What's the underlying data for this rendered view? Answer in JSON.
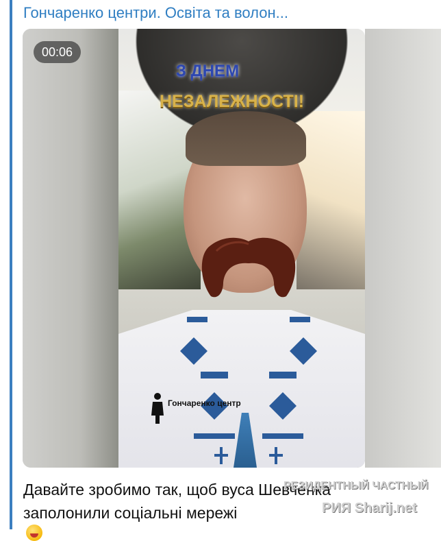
{
  "message": {
    "channel_title": "Гончаренко центри. Освіта та волон...",
    "caption_line1": "Давайте зробимо так, щоб вуса Шевченка",
    "caption_line2": "заполонили соціальні мережі",
    "caption_emoji": "face-with-tongue-emoji"
  },
  "video": {
    "duration": "00:06",
    "overlay_line1": "З ДНЕМ",
    "overlay_line2": "НЕЗАЛЕЖНОСТІ!",
    "logo_name": "Гончаренко центр"
  },
  "watermark": {
    "line1": "РЕЗИДЕНТНЫЙ ЧАСТНЫЙ",
    "line2": "РИЯ Sharij.net"
  },
  "colors": {
    "accent": "#3c7fc0",
    "title": "#2f7ec2",
    "caption_text": "#111111"
  }
}
